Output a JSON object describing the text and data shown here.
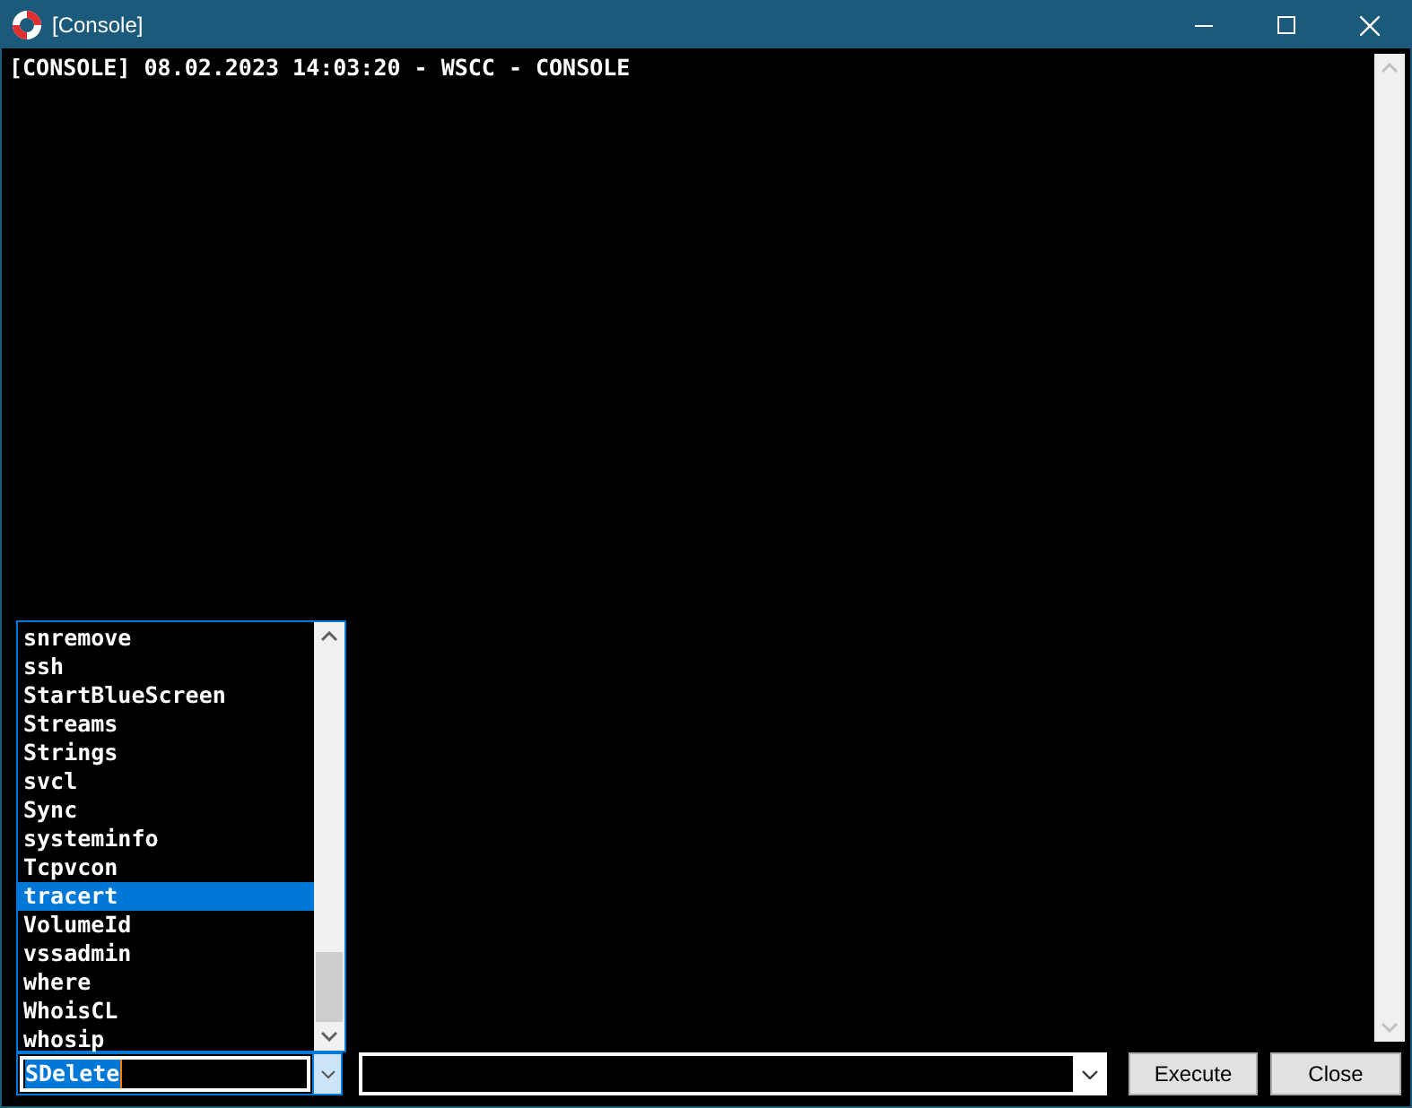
{
  "window": {
    "title": "[Console]"
  },
  "console": {
    "lines": [
      "[CONSOLE] 08.02.2023 14:03:20 - WSCC - CONSOLE"
    ]
  },
  "command_list": {
    "items": [
      {
        "label": "snremove",
        "selected": false
      },
      {
        "label": "ssh",
        "selected": false
      },
      {
        "label": "StartBlueScreen",
        "selected": false
      },
      {
        "label": "Streams",
        "selected": false
      },
      {
        "label": "Strings",
        "selected": false
      },
      {
        "label": "svcl",
        "selected": false
      },
      {
        "label": "Sync",
        "selected": false
      },
      {
        "label": "systeminfo",
        "selected": false
      },
      {
        "label": "Tcpvcon",
        "selected": false
      },
      {
        "label": "tracert",
        "selected": true
      },
      {
        "label": "VolumeId",
        "selected": false
      },
      {
        "label": "vssadmin",
        "selected": false
      },
      {
        "label": "where",
        "selected": false
      },
      {
        "label": "WhoisCL",
        "selected": false
      },
      {
        "label": "whosip",
        "selected": false
      }
    ]
  },
  "command_combo": {
    "value": "SDelete"
  },
  "buttons": [
    "Execute",
    "Close"
  ]
}
